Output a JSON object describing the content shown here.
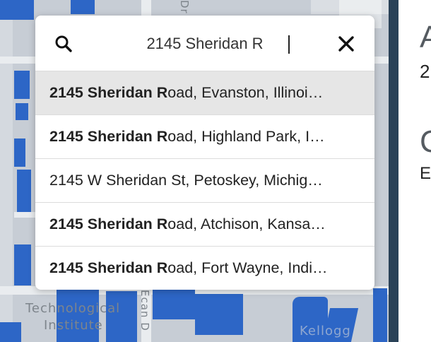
{
  "map": {
    "labels": {
      "institute_line1": "Technological",
      "institute_line2": "Institute",
      "place_right": "Kellogg",
      "street_top": "Dr",
      "street_mid": "Ecan D"
    },
    "colors": {
      "water_buildings": "#2d66c6",
      "background": "#c7cdd5"
    }
  },
  "panel": {
    "line1": "A",
    "line2": "2",
    "line3": "C",
    "line4": "E"
  },
  "search": {
    "value": "2145 Sheridan R",
    "search_icon": "search-icon",
    "clear_icon": "close-icon"
  },
  "results": [
    {
      "bold": "2145 Sheridan R",
      "rest": "oad, Evanston, Illinoi…",
      "highlighted": true
    },
    {
      "bold": "2145 Sheridan R",
      "rest": "oad, Highland Park, I…",
      "highlighted": false
    },
    {
      "bold": "",
      "rest": "2145 W Sheridan St, Petoskey, Michig…",
      "highlighted": false
    },
    {
      "bold": "2145 Sheridan R",
      "rest": "oad, Atchison, Kansa…",
      "highlighted": false
    },
    {
      "bold": "2145 Sheridan R",
      "rest": "oad, Fort Wayne, Indi…",
      "highlighted": false
    }
  ]
}
